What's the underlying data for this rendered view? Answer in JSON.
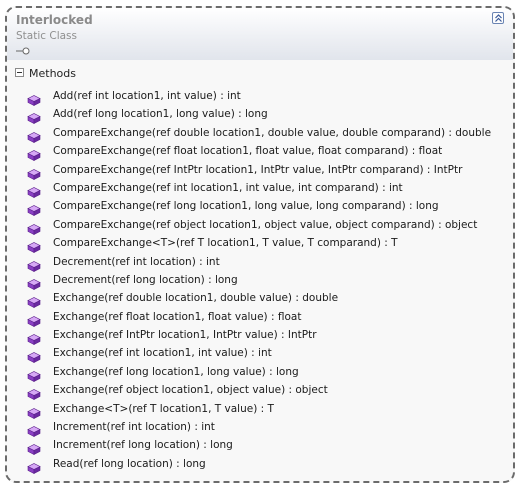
{
  "class_shape": {
    "title": "Interlocked",
    "kind": "Static Class",
    "sections": [
      {
        "label": "Methods",
        "members": [
          "Add(ref int location1, int value) : int",
          "Add(ref long location1, long value) : long",
          "CompareExchange(ref double location1, double value, double comparand) : double",
          "CompareExchange(ref float location1, float value, float comparand) : float",
          "CompareExchange(ref IntPtr location1, IntPtr value, IntPtr comparand) : IntPtr",
          "CompareExchange(ref int location1, int value, int comparand) : int",
          "CompareExchange(ref long location1, long value, long comparand) : long",
          "CompareExchange(ref object location1, object value, object comparand) : object",
          "CompareExchange<T>(ref T location1, T value, T comparand) : T",
          "Decrement(ref int location) : int",
          "Decrement(ref long location) : long",
          "Exchange(ref double location1, double value) : double",
          "Exchange(ref float location1, float value) : float",
          "Exchange(ref IntPtr location1, IntPtr value) : IntPtr",
          "Exchange(ref int location1, int value) : int",
          "Exchange(ref long location1, long value) : long",
          "Exchange(ref object location1, object value) : object",
          "Exchange<T>(ref T location1, T value) : T",
          "Increment(ref int location) : int",
          "Increment(ref long location) : long",
          "Read(ref long location) : long"
        ]
      }
    ]
  },
  "icons": {
    "member": "method-cube-icon",
    "collapse": "double-chevron-up-icon",
    "section_toggle": "minus-box-icon",
    "interface": "lollipop-icon"
  },
  "colors": {
    "border": "#6b6b6b",
    "method_icon": "#8a3fc4",
    "title": "#8a8a8a"
  }
}
